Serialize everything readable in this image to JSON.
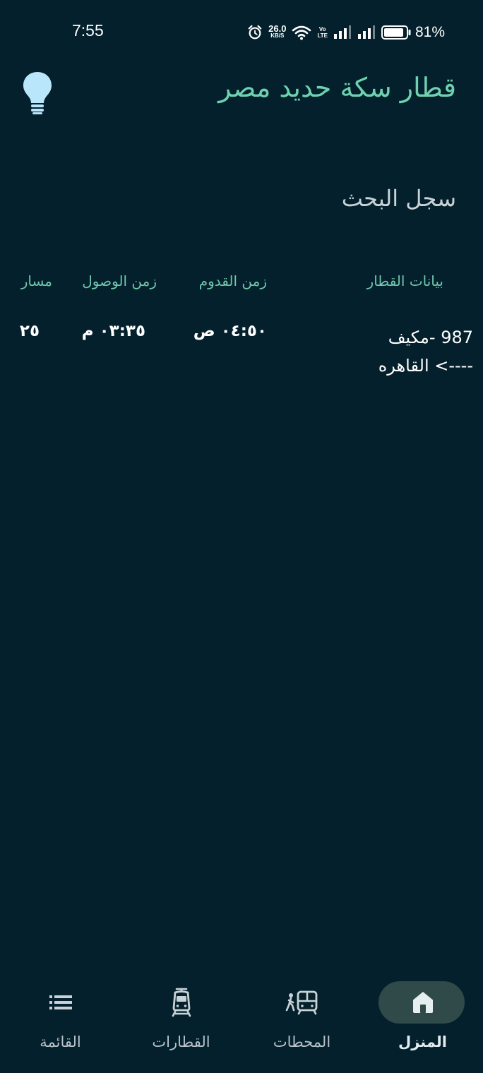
{
  "status_bar": {
    "time": "7:55",
    "net_speed_value": "26.0",
    "net_speed_unit": "KB/S",
    "volte_top": "Vo",
    "volte_bottom": "LTE",
    "battery": "81%",
    "icons": [
      "alarm-icon",
      "wifi-icon",
      "volte-icon",
      "signal-icon",
      "signal-icon",
      "battery-icon"
    ]
  },
  "header": {
    "title": "قطار سكة حديد مصر",
    "theme_icon": "lightbulb-icon"
  },
  "history": {
    "title": "سجل البحث",
    "columns": {
      "train": "بيانات القطار",
      "departure": "زمن القدوم",
      "arrival": "زمن الوصول",
      "track": "مسار"
    },
    "rows": [
      {
        "train_line1": "987 -مكيف",
        "train_line2": "----> القاهره",
        "departure": "٠٤:٥٠ ص",
        "arrival": "٠٣:٣٥ م",
        "track": "٢٥"
      }
    ]
  },
  "bottom_nav": {
    "items": [
      {
        "label": "المنزل",
        "icon": "home-icon",
        "active": true
      },
      {
        "label": "المحطات",
        "icon": "station-icon",
        "active": false
      },
      {
        "label": "القطارات",
        "icon": "train-icon",
        "active": false
      },
      {
        "label": "القائمة",
        "icon": "list-icon",
        "active": false
      }
    ]
  },
  "colors": {
    "background": "#03202c",
    "accent": "#6fd1b0",
    "nav_active_pill": "#2f4a49"
  }
}
